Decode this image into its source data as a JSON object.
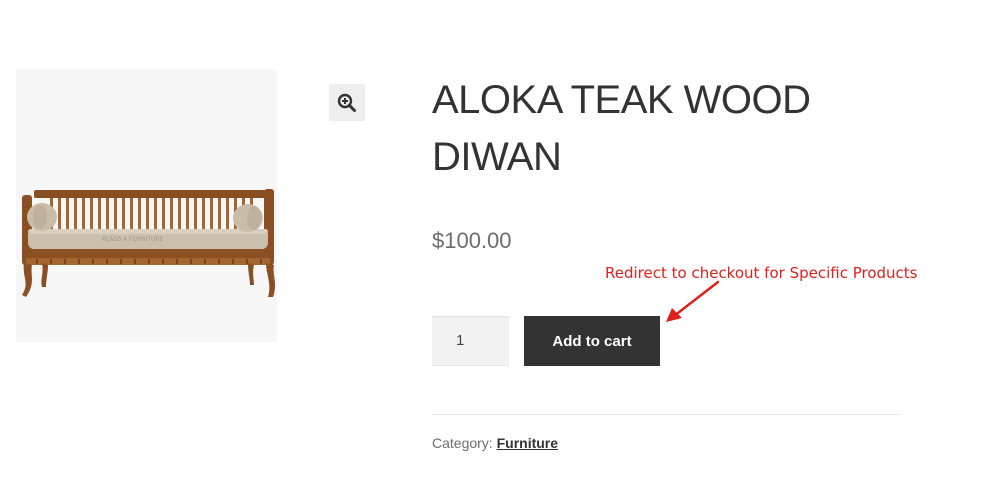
{
  "product": {
    "title": "ALOKA TEAK WOOD DIWAN",
    "price": "$100.00",
    "image_alt": "Aloka teak wood diwan with beige cushion and two bolster pillows",
    "image_watermark": "KLASS A FURNITURE",
    "quantity": "1",
    "add_to_cart_label": "Add to cart",
    "category_label": "Category:",
    "category_value": "Furniture"
  },
  "zoom": {
    "icon": "magnifier-plus-icon"
  },
  "annotation": {
    "text": "Redirect to checkout for Specific Products",
    "color": "#e0201a"
  },
  "colors": {
    "button_bg": "#333333",
    "button_text": "#ffffff",
    "price": "#6d6d6d",
    "input_bg": "#f2f2f2",
    "image_bg": "#f7f7f7"
  }
}
